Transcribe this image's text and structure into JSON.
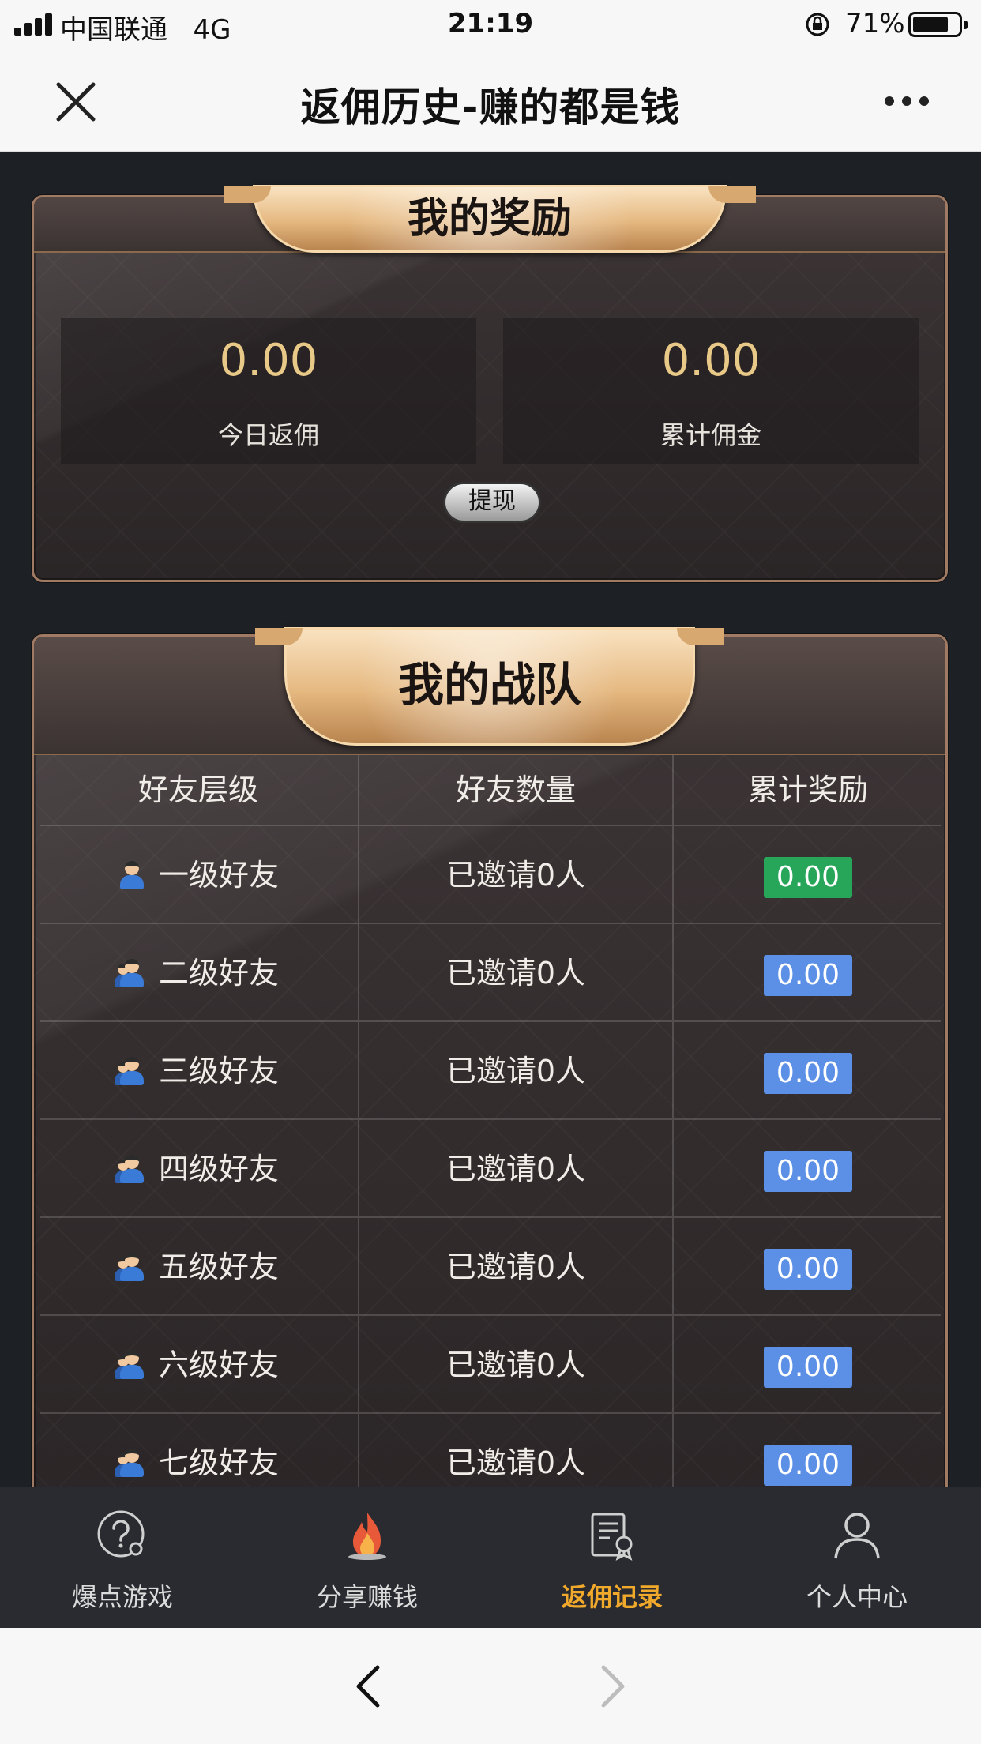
{
  "status_bar": {
    "carrier": "中国联通",
    "network": "4G",
    "time": "21:19",
    "battery": "71%"
  },
  "nav": {
    "title": "返佣历史-赚的都是钱"
  },
  "rewards": {
    "title": "我的奖励",
    "today_value": "0.00",
    "today_label": "今日返佣",
    "total_value": "0.00",
    "total_label": "累计佣金",
    "withdraw_label": "提现"
  },
  "team": {
    "title": "我的战队",
    "headers": [
      "好友层级",
      "好友数量",
      "累计奖励"
    ],
    "rows": [
      {
        "level": "一级好友",
        "count": "已邀请0人",
        "reward": "0.00"
      },
      {
        "level": "二级好友",
        "count": "已邀请0人",
        "reward": "0.00"
      },
      {
        "level": "三级好友",
        "count": "已邀请0人",
        "reward": "0.00"
      },
      {
        "level": "四级好友",
        "count": "已邀请0人",
        "reward": "0.00"
      },
      {
        "level": "五级好友",
        "count": "已邀请0人",
        "reward": "0.00"
      },
      {
        "level": "六级好友",
        "count": "已邀请0人",
        "reward": "0.00"
      },
      {
        "level": "七级好友",
        "count": "已邀请0人",
        "reward": "0.00"
      }
    ]
  },
  "tabs": [
    {
      "label": "爆点游戏",
      "icon": "help-game-icon"
    },
    {
      "label": "分享赚钱",
      "icon": "fire-icon"
    },
    {
      "label": "返佣记录",
      "icon": "certificate-icon"
    },
    {
      "label": "个人中心",
      "icon": "user-icon"
    }
  ],
  "colors": {
    "accent": "#f0a92a",
    "gold_value": "#e8c987",
    "badge_blue": "#5c8fe6",
    "badge_green": "#27a65a"
  }
}
